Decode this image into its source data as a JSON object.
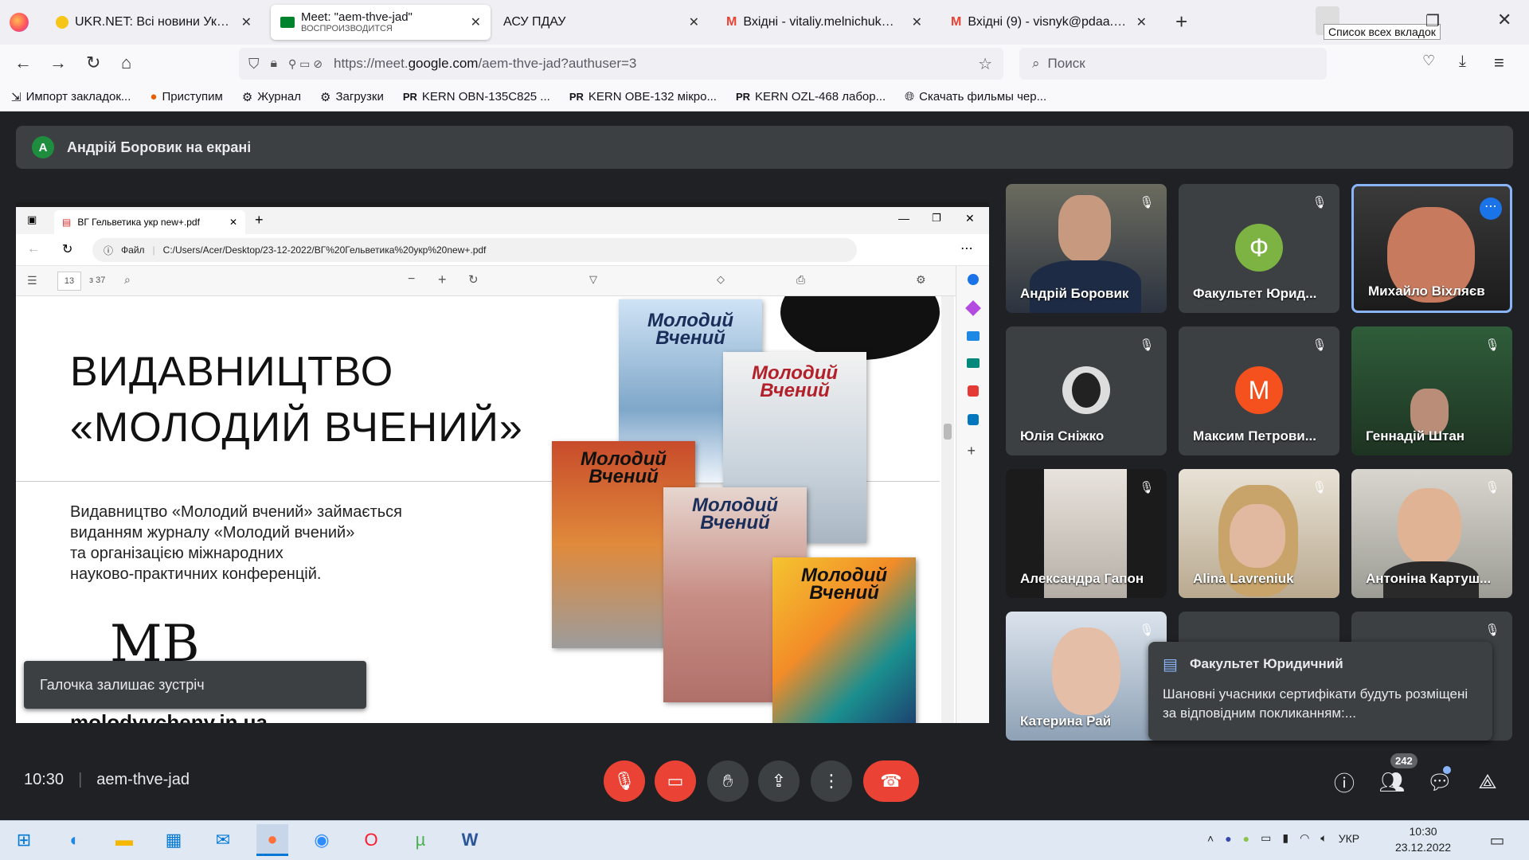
{
  "browser": {
    "tabs": [
      {
        "title": "UKR.NET: Всі новини України, ос",
        "sub": ""
      },
      {
        "title": "Meet: \"aem-thve-jad\"",
        "sub": "ВОСПРОИЗВОДИТСЯ"
      },
      {
        "title": "АСУ ПДАУ",
        "sub": ""
      },
      {
        "title": "Вхідні - vitaliy.melnichuk@pdaa.e",
        "sub": ""
      },
      {
        "title": "Вхідні (9) - visnyk@pdaa.edu.ua",
        "sub": ""
      }
    ],
    "tooltip": "Список всех вкладок",
    "url_prefix": "https://meet.",
    "url_domain": "google.com",
    "url_rest": "/aem-thve-jad?authuser=3",
    "search_placeholder": "Поиск",
    "bookmarks": [
      "Импорт закладок...",
      "Приступим",
      "Журнал",
      "Загрузки",
      "KERN OBN-135C825 ...",
      "KERN OBE-132 мікро...",
      "KERN OZL-468 лабор...",
      "Скачать фильмы чер..."
    ]
  },
  "meet": {
    "presenter_initial": "A",
    "presenter_banner": "Андрій Боровик на екрані",
    "meeting_time": "10:30",
    "meeting_code": "aem-thve-jad",
    "participants_count": "242",
    "toast": "Галочка залишає зустріч",
    "chat": {
      "sender": "Факультет Юридичний",
      "message": "Шановні учасники сертифікати будуть розміщені за відповідним покликанням:..."
    },
    "tiles": [
      {
        "name": "Андрій Боровик"
      },
      {
        "name": "Факультет Юрид...",
        "initial": "Ф",
        "color": "#7cb342"
      },
      {
        "name": "Михайло Віхляєв"
      },
      {
        "name": "Юлія Сніжко"
      },
      {
        "name": "Максим Петрови...",
        "initial": "М",
        "color": "#f4511e"
      },
      {
        "name": "Геннадій Штан"
      },
      {
        "name": "Александра Гапон"
      },
      {
        "name": "Alina Lavreniuk"
      },
      {
        "name": "Антоніна Картуш..."
      },
      {
        "name": "Катерина Рай"
      }
    ]
  },
  "shared": {
    "edge_tab": "ВГ Гельветика укр new+.pdf",
    "file_label": "Файл",
    "path": "C:/Users/Acer/Desktop/23-12-2022/ВГ%20Гельветика%20укр%20new+.pdf",
    "page_num": "13",
    "page_total": "з 37",
    "headline1": "ВИДАВНИЦТВО",
    "headline2": "«МОЛОДИЙ ВЧЕНИЙ»",
    "body": [
      "Видавництво «Молодий вчений» займається",
      "виданням журналу «Молодий вчений»",
      "та організацією міжнародних",
      "науково-практичних конференцій."
    ],
    "site": "molodyvcheny.in.ua",
    "logo": "МВ",
    "cover_title1": "Молодий",
    "cover_title2": "Вчений"
  },
  "taskbar": {
    "lang": "УКР",
    "time": "10:30",
    "date": "23.12.2022"
  }
}
